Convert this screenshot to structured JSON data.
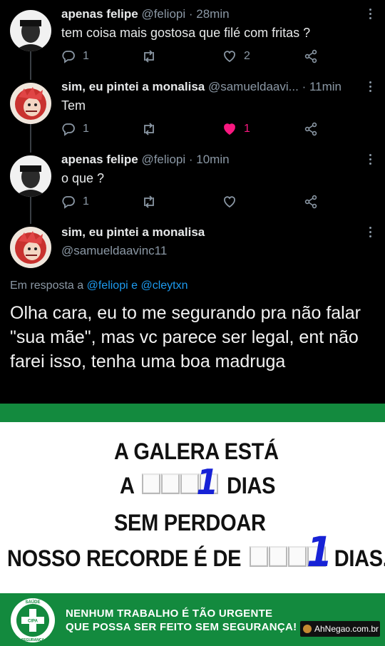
{
  "tweets": [
    {
      "name": "apenas felipe",
      "handle": "@feliopi",
      "time": "· 28min",
      "text": "tem coisa mais gostosa que filé com fritas ?",
      "replies": "1",
      "retweets": "",
      "likes": "2",
      "liked": false
    },
    {
      "name": "sim, eu pintei a monalisa",
      "handle": "@samueldaavi...",
      "time": "· 11min",
      "text": "Tem",
      "replies": "1",
      "retweets": "",
      "likes": "1",
      "liked": true
    },
    {
      "name": "apenas felipe",
      "handle": "@feliopi",
      "time": "· 10min",
      "text": "o que ?",
      "replies": "1",
      "retweets": "",
      "likes": "",
      "liked": false
    }
  ],
  "main_tweet": {
    "name": "sim, eu pintei a monalisa",
    "handle": "@samueldaavinc11",
    "reply_prefix": "Em resposta a",
    "reply_mention_1": "@feliopi",
    "reply_and": "e",
    "reply_mention_2": "@cleytxn",
    "text": "Olha cara, eu to me segurando pra não falar \"sua mãe\", mas vc parece ser legal, ent não farei isso, tenha uma boa madruga"
  },
  "sign": {
    "line1": "A GALERA ESTÁ",
    "line2_pre": "A",
    "line2_post": "DIAS",
    "days_count": "1",
    "line3": "SEM PERDOAR",
    "line4_pre": "NOSSO RECORDE É DE",
    "line4_post": "DIAS.",
    "record_count": "1",
    "footer_line1": "NENHUM TRABALHO É TÃO URGENTE",
    "footer_line2": "QUE POSSA SER FEITO SEM SEGURANÇA!",
    "logo_top": "SAÚDE",
    "logo_mid": "CIPA",
    "logo_bottom": "SEGURANÇA",
    "watermark": "AhNegao.com.br"
  },
  "icons": {
    "reply": "reply-icon",
    "retweet": "retweet-icon",
    "like": "heart-icon",
    "share": "share-icon",
    "more": "more-icon"
  },
  "colors": {
    "background": "#000000",
    "link": "#1d9bf0",
    "liked": "#f91880",
    "muted": "#8b98a5",
    "sign_green": "#138a3e",
    "digit_blue": "#1722d6"
  }
}
